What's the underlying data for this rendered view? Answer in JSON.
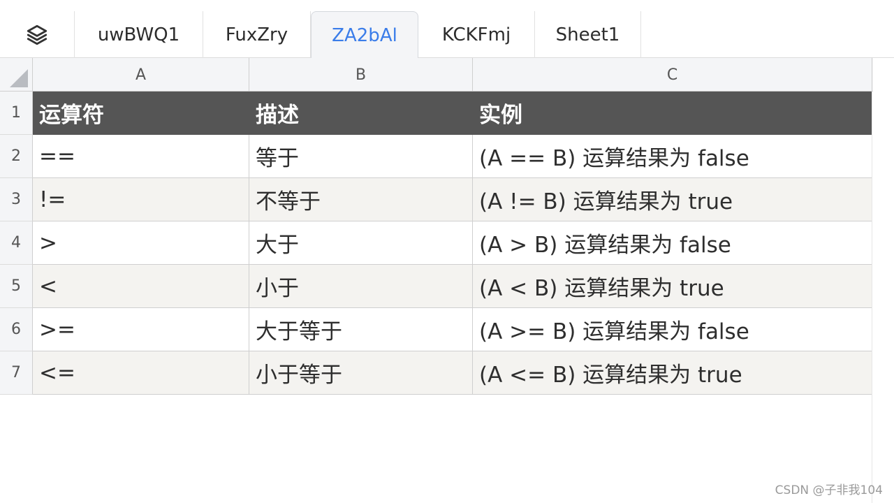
{
  "tabs": [
    {
      "label": "uwBWQ1"
    },
    {
      "label": "FuxZry"
    },
    {
      "label": "ZA2bAl",
      "active": true
    },
    {
      "label": "KCKFmj"
    },
    {
      "label": "Sheet1"
    }
  ],
  "columns": [
    "A",
    "B",
    "C"
  ],
  "rows": [
    "1",
    "2",
    "3",
    "4",
    "5",
    "6",
    "7"
  ],
  "table": {
    "header": [
      "运算符",
      "描述",
      "实例"
    ],
    "body": [
      [
        "==",
        "等于",
        "(A == B) 运算结果为 false"
      ],
      [
        "!=",
        "不等于",
        "(A != B) 运算结果为 true"
      ],
      [
        ">",
        "大于",
        "(A > B) 运算结果为 false"
      ],
      [
        "<",
        "小于",
        "(A < B) 运算结果为 true"
      ],
      [
        ">=",
        "大于等于",
        "(A >= B) 运算结果为 false"
      ],
      [
        "<=",
        "小于等于",
        "(A <= B) 运算结果为 true"
      ]
    ]
  },
  "watermark": "CSDN @子非我104",
  "colors": {
    "active_tab_text": "#3b7de9",
    "header_row_bg": "#555555",
    "alt_row_bg": "#f4f3f0",
    "gutter_bg": "#f4f5f7"
  },
  "icons": {
    "sheet_list": "layers-icon",
    "select_all": "select-all-triangle-icon"
  }
}
